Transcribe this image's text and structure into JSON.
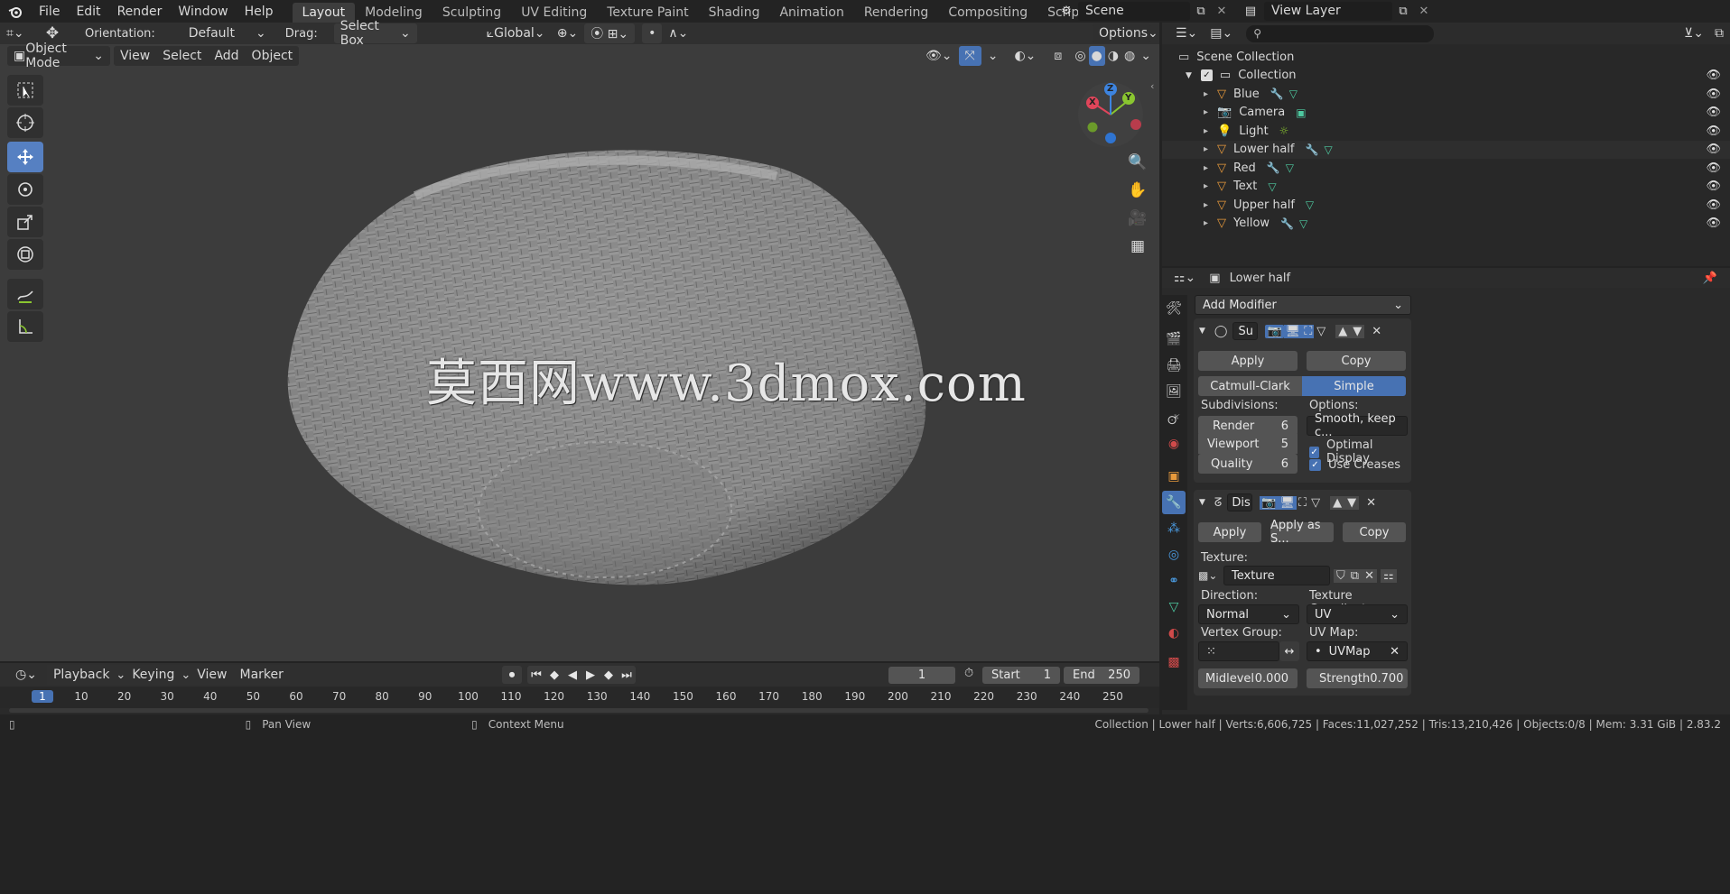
{
  "topbar": {
    "menus": [
      "File",
      "Edit",
      "Render",
      "Window",
      "Help"
    ],
    "workspaces": [
      "Layout",
      "Modeling",
      "Sculpting",
      "UV Editing",
      "Texture Paint",
      "Shading",
      "Animation",
      "Rendering",
      "Compositing",
      "Scripting"
    ],
    "active_workspace": "Layout",
    "scene": "Scene",
    "view_layer": "View Layer"
  },
  "viewport": {
    "orientation_label": "Orientation:",
    "orientation_value": "Default",
    "drag_label": "Drag:",
    "drag_value": "Select Box",
    "transform_space": "Global",
    "options_label": "Options",
    "mode": "Object Mode",
    "menus": [
      "View",
      "Select",
      "Add",
      "Object"
    ],
    "watermark": "莫西网www.3dmox.com",
    "gizmo": {
      "x": "X",
      "y": "Y",
      "z": "Z"
    },
    "colors": {
      "x": "#e0455a",
      "y": "#8ac630",
      "z": "#3d84e0",
      "active_tool": "#5680c2"
    }
  },
  "outliner": {
    "search_placeholder": "",
    "root": "Scene Collection",
    "collection": "Collection",
    "items": [
      {
        "name": "Blue",
        "icon": "mesh-icon",
        "extras": [
          "wrench-icon",
          "vertex-data-icon"
        ]
      },
      {
        "name": "Camera",
        "icon": "camera-icon",
        "extras": [
          "camera-data-icon"
        ]
      },
      {
        "name": "Light",
        "icon": "light-icon",
        "extras": [
          "sun-icon"
        ]
      },
      {
        "name": "Lower half",
        "icon": "mesh-icon",
        "extras": [
          "wrench-icon",
          "vertex-data-icon"
        ]
      },
      {
        "name": "Red",
        "icon": "mesh-icon",
        "extras": [
          "wrench-icon",
          "vertex-data-icon"
        ]
      },
      {
        "name": "Text",
        "icon": "mesh-icon",
        "extras": [
          "vertex-data-icon"
        ]
      },
      {
        "name": "Upper half",
        "icon": "mesh-icon",
        "extras": [
          "vertex-data-icon"
        ]
      },
      {
        "name": "Yellow",
        "icon": "mesh-icon",
        "extras": [
          "wrench-icon",
          "vertex-data-icon"
        ]
      }
    ]
  },
  "properties": {
    "object_name": "Lower half",
    "add_modifier": "Add Modifier",
    "subsurf": {
      "name": "Su",
      "apply": "Apply",
      "copy": "Copy",
      "algo_options": [
        "Catmull-Clark",
        "Simple"
      ],
      "algo_selected": "Simple",
      "subdivisions_label": "Subdivisions:",
      "options_label": "Options:",
      "render_label": "Render",
      "render_value": "6",
      "viewport_label": "Viewport",
      "viewport_value": "5",
      "quality_label": "Quality",
      "quality_value": "6",
      "uv_smooth": "Smooth, keep c...",
      "optimal_display": "Optimal Display",
      "use_creases": "Use Creases"
    },
    "displace": {
      "name": "Dis",
      "apply": "Apply",
      "apply_as_shape": "Apply as S...",
      "copy": "Copy",
      "texture_label": "Texture:",
      "texture_value": "Texture",
      "direction_label": "Direction:",
      "direction_value": "Normal",
      "tex_coords_label": "Texture Coordinate...",
      "tex_coords_value": "UV",
      "vertex_group_label": "Vertex Group:",
      "uv_map_label": "UV Map:",
      "uv_map_value": "UVMap",
      "midlevel_label": "Midlevel",
      "midlevel_value": "0.000",
      "strength_label": "Strength",
      "strength_value": "0.700"
    }
  },
  "timeline": {
    "menus": [
      "Playback",
      "Keying",
      "View",
      "Marker"
    ],
    "current_frame": "1",
    "start_label": "Start",
    "start_value": "1",
    "end_label": "End",
    "end_value": "250",
    "ruler": [
      "1",
      "10",
      "20",
      "30",
      "40",
      "50",
      "60",
      "70",
      "80",
      "90",
      "100",
      "110",
      "120",
      "130",
      "140",
      "150",
      "160",
      "170",
      "180",
      "190",
      "200",
      "210",
      "220",
      "230",
      "240",
      "250"
    ]
  },
  "statusbar": {
    "pan": "Pan View",
    "context": "Context Menu",
    "stats": "Collection | Lower half | Verts:6,606,725 | Faces:11,027,252 | Tris:13,210,426 | Objects:0/8 | Mem: 3.31 GiB | 2.83.2"
  }
}
